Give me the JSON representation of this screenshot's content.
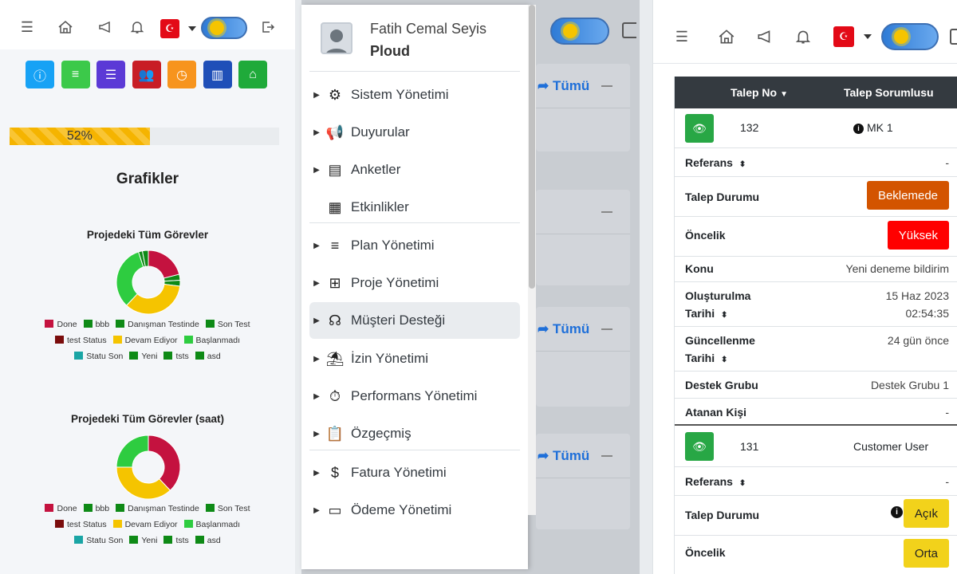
{
  "colors": {
    "green": "#28a745",
    "orange_badge": "#d35400",
    "red_badge": "#ff0000",
    "yellow_badge": "#f2d21b",
    "link_blue": "#1e6fd9",
    "table_header": "#343a40"
  },
  "panel1": {
    "topbar_icons": [
      "hamburger-icon",
      "home-icon",
      "megaphone-icon",
      "bell-icon",
      "turkey-flag-icon",
      "theme-toggle",
      "logout-icon"
    ],
    "quick_buttons": [
      {
        "name": "info-icon",
        "color": "#17a2f5",
        "glyph": "ⓘ"
      },
      {
        "name": "align-icon",
        "color": "#3cc94a",
        "glyph": "≡"
      },
      {
        "name": "task-list-icon",
        "color": "#5b3ad6",
        "glyph": "☰"
      },
      {
        "name": "users-icon",
        "color": "#c81d25",
        "glyph": "👥"
      },
      {
        "name": "clock-icon",
        "color": "#f7941d",
        "glyph": "◷"
      },
      {
        "name": "kanban-icon",
        "color": "#1f4fb8",
        "glyph": "▥"
      },
      {
        "name": "home-icon",
        "color": "#1faa3a",
        "glyph": "⌂"
      }
    ],
    "progress": {
      "value": 52,
      "label": "52%"
    },
    "section_title": "Grafikler",
    "legend": [
      {
        "label": "Done",
        "color": "#c4123f"
      },
      {
        "label": "bbb",
        "color": "#0e8a16"
      },
      {
        "label": "Danışman Testinde",
        "color": "#0e8a16"
      },
      {
        "label": "Son Test",
        "color": "#0e8a16"
      },
      {
        "label": "test Status",
        "color": "#7a0c0c"
      },
      {
        "label": "Devam Ediyor",
        "color": "#f5c400"
      },
      {
        "label": "Başlanmadı",
        "color": "#2ecc40"
      },
      {
        "label": "Statu Son",
        "color": "#1aa5a5"
      },
      {
        "label": "Yeni",
        "color": "#0e8a16"
      },
      {
        "label": "tsts",
        "color": "#0e8a16"
      },
      {
        "label": "asd",
        "color": "#0e8a16"
      }
    ],
    "chart_data": [
      {
        "type": "pie",
        "title": "Projedeki Tüm Görevler",
        "categories": [
          "Done",
          "bbb",
          "Danışman Testinde",
          "Son Test",
          "test Status",
          "Devam Ediyor",
          "Başlanmadı",
          "Statu Son",
          "Yeni",
          "tsts",
          "asd"
        ],
        "values": [
          21,
          0,
          3,
          3,
          0,
          35,
          33,
          0,
          2,
          0,
          3
        ],
        "colors": [
          "#c4123f",
          "#0e8a16",
          "#0e8a16",
          "#0e8a16",
          "#7a0c0c",
          "#f5c400",
          "#2ecc40",
          "#1aa5a5",
          "#0e8a16",
          "#0e8a16",
          "#0e8a16"
        ],
        "legend": "bottom"
      },
      {
        "type": "pie",
        "title": "Projedeki Tüm Görevler (saat)",
        "categories": [
          "Done",
          "bbb",
          "Danışman Testinde",
          "Son Test",
          "test Status",
          "Devam Ediyor",
          "Başlanmadı",
          "Statu Son",
          "Yeni",
          "tsts",
          "asd"
        ],
        "values": [
          38,
          0,
          0,
          0,
          0,
          37,
          25,
          0,
          0,
          0,
          0
        ],
        "colors": [
          "#c4123f",
          "#0e8a16",
          "#0e8a16",
          "#0e8a16",
          "#7a0c0c",
          "#f5c400",
          "#2ecc40",
          "#1aa5a5",
          "#0e8a16",
          "#0e8a16",
          "#0e8a16"
        ],
        "legend": "bottom"
      }
    ]
  },
  "panel2": {
    "user_name": "Fatih Cemal Seyis",
    "company": "Ploud",
    "menu": [
      {
        "label": "Sistem Yönetimi",
        "icon": "gear-box-icon",
        "glyph": "⚙",
        "arrow": true
      },
      {
        "label": "Duyurular",
        "icon": "bullhorn-icon",
        "glyph": "📢",
        "arrow": true
      },
      {
        "label": "Anketler",
        "icon": "survey-icon",
        "glyph": "▤",
        "arrow": true
      },
      {
        "label": "Etkinlikler",
        "icon": "calendar-icon",
        "glyph": "▦",
        "arrow": false
      },
      {
        "label": "Plan Yönetimi",
        "icon": "list-icon",
        "glyph": "≡",
        "arrow": true
      },
      {
        "label": "Proje Yönetimi",
        "icon": "project-tree-icon",
        "glyph": "⊞",
        "arrow": true
      },
      {
        "label": "Müşteri Desteği",
        "icon": "headset-icon",
        "glyph": "☊",
        "arrow": true
      },
      {
        "label": "İzin Yönetimi",
        "icon": "umbrella-beach-icon",
        "glyph": "⛱",
        "arrow": true
      },
      {
        "label": "Performans Yönetimi",
        "icon": "stopwatch-icon",
        "glyph": "⏱",
        "arrow": true
      },
      {
        "label": "Özgeçmiş",
        "icon": "clipboard-icon",
        "glyph": "📋",
        "arrow": true
      },
      {
        "label": "Fatura Yönetimi",
        "icon": "dollar-icon",
        "glyph": "$",
        "arrow": true
      },
      {
        "label": "Ödeme Yönetimi",
        "icon": "credit-card-icon",
        "glyph": "▭",
        "arrow": true
      }
    ],
    "active_index": 6,
    "card_link": "Tümü"
  },
  "panel3": {
    "headers": {
      "col1": "Talep No",
      "col2": "Talep Sorumlusu"
    },
    "r1": {
      "no": "132",
      "owner": "MK 1",
      "referans_label": "Referans",
      "referans": "-",
      "durum_label": "Talep Durumu",
      "durum": "Beklemede",
      "oncelik_label": "Öncelik",
      "oncelik": "Yüksek",
      "konu_label": "Konu",
      "konu": "Yeni deneme bildirim",
      "olusturulma_label_1": "Oluşturulma",
      "olusturulma_label_2": "Tarihi",
      "olusturulma_date": "15 Haz 2023",
      "olusturulma_time": "02:54:35",
      "guncellenme_label_1": "Güncellenme",
      "guncellenme_label_2": "Tarihi",
      "guncellenme": "24 gün önce",
      "destek_label": "Destek Grubu",
      "destek": "Destek Grubu 1",
      "atanan_label": "Atanan Kişi",
      "atanan": "-"
    },
    "r2": {
      "no": "131",
      "owner": "Customer User",
      "referans_label": "Referans",
      "referans": "-",
      "durum_label": "Talep Durumu",
      "durum": "Açık",
      "oncelik_label": "Öncelik",
      "oncelik": "Orta"
    }
  }
}
